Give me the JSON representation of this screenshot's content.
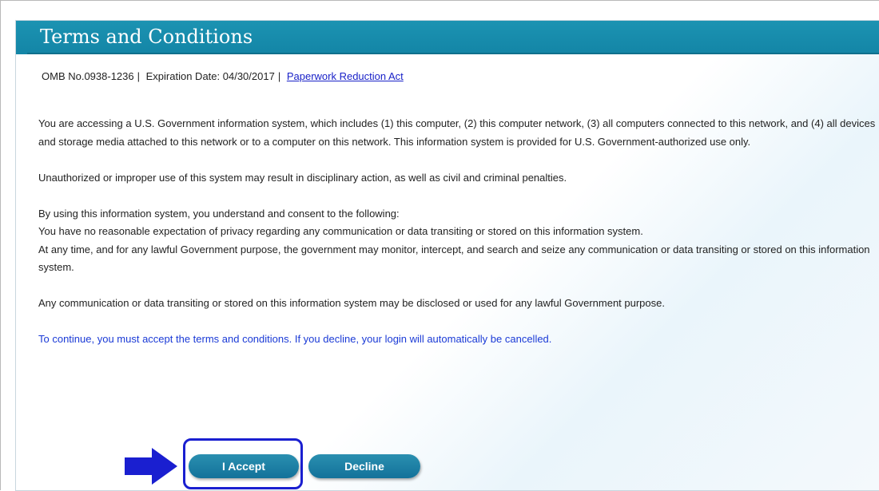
{
  "header": {
    "title": "Terms and Conditions"
  },
  "omb": {
    "number": "OMB No.0938-1236",
    "separator": "|",
    "expiration": "Expiration Date: 04/30/2017",
    "link": "Paperwork Reduction Act"
  },
  "paragraphs": {
    "p1": "You are accessing a U.S. Government information system, which includes (1) this computer, (2) this computer network, (3) all computers connected to this network, and (4) all devices and storage media attached to this network or to a computer on this network. This information system is provided for U.S. Government-authorized use only.",
    "p2": "Unauthorized or improper use of this system may result in disciplinary action, as well as civil and criminal penalties.",
    "p3a": "By using this information system, you understand and consent to the following:",
    "p3b": "You have no reasonable expectation of privacy regarding any communication or data transiting or stored on this information system.",
    "p3c": "At any time, and for any lawful Government purpose, the government may monitor, intercept, and search and seize any communication or data transiting or stored on this information system.",
    "p4": "Any communication or data transiting or stored on this information system may be disclosed or used for any lawful Government purpose.",
    "notice": "To continue, you must accept the terms and conditions. If you decline, your login will automatically be cancelled."
  },
  "actions": {
    "accept_label": "I Accept",
    "decline_label": "Decline"
  },
  "colors": {
    "title_bar": "#1385a6",
    "button": "#13729a",
    "link": "#1a22c8",
    "notice_text": "#1a3ad6",
    "highlight": "#1a1fd0"
  }
}
